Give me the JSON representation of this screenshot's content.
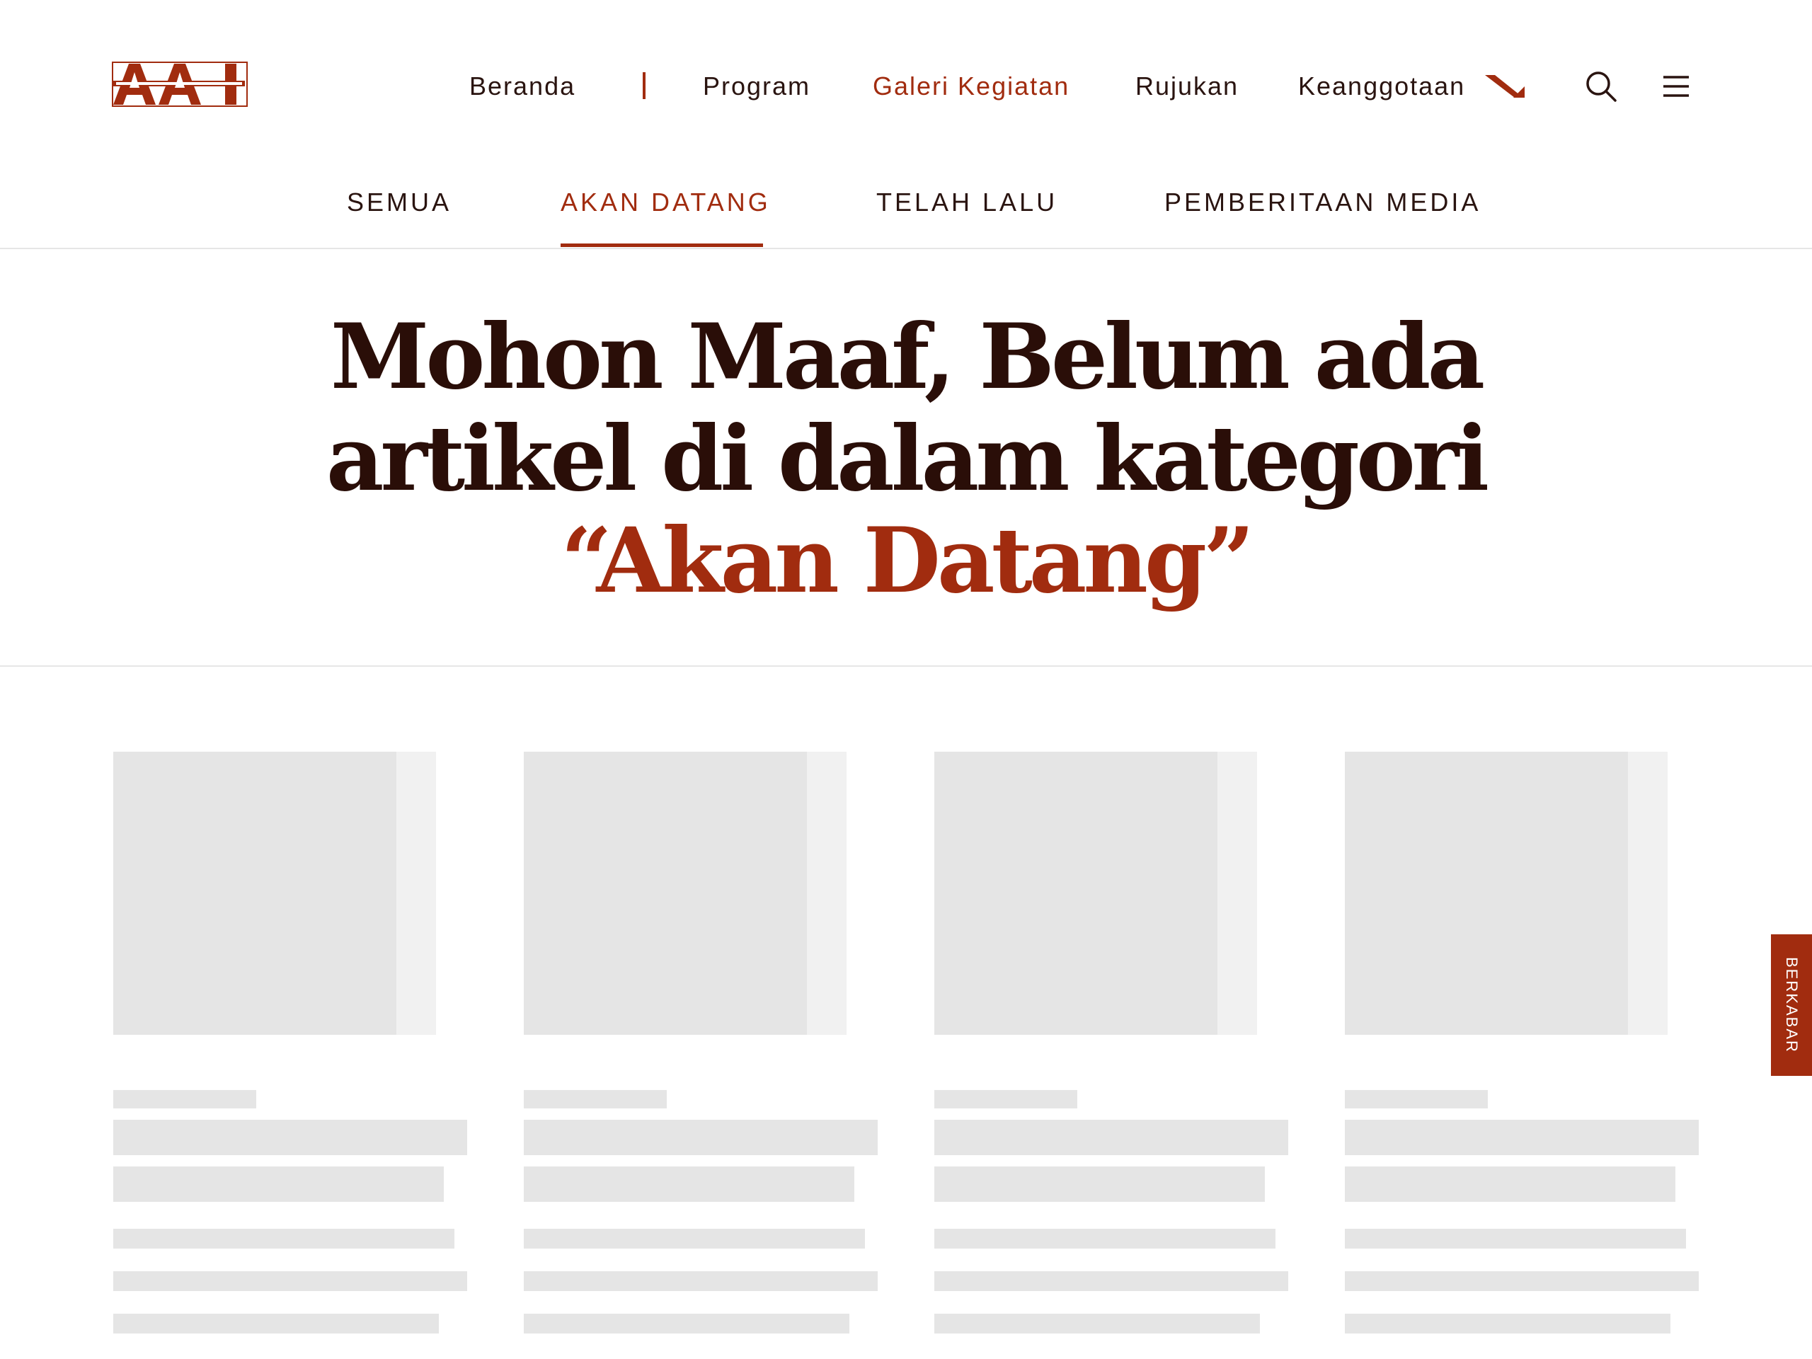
{
  "colors": {
    "brand": "#a12c0f",
    "text": "#2a1410",
    "skeleton": "#e5e5e5",
    "skeleton_light": "#f1f1f1"
  },
  "logo": {
    "text": "AAI",
    "icon": "aai-logo"
  },
  "nav": {
    "items": [
      {
        "label": "Beranda",
        "active": false
      },
      {
        "label": "Program",
        "active": false
      },
      {
        "label": "Galeri Kegiatan",
        "active": true
      },
      {
        "label": "Rujukan",
        "active": false
      },
      {
        "label": "Keanggotaan",
        "active": false
      }
    ],
    "icons": [
      "divider-bar-icon",
      "diagonal-arrow-icon",
      "search-icon",
      "menu-icon"
    ]
  },
  "tabs": [
    {
      "label": "SEMUA",
      "active": false
    },
    {
      "label": "AKAN DATANG",
      "active": true
    },
    {
      "label": "TELAH LALU",
      "active": false
    },
    {
      "label": "PEMBERITAAN MEDIA",
      "active": false
    }
  ],
  "hero": {
    "line1": "Mohon Maaf, Belum ada",
    "line2": "artikel di dalam kategori",
    "accent": "“Akan Datang”"
  },
  "cards": {
    "count": 4,
    "state": "loading"
  },
  "floating_tab": {
    "label": "BERKABAR"
  }
}
